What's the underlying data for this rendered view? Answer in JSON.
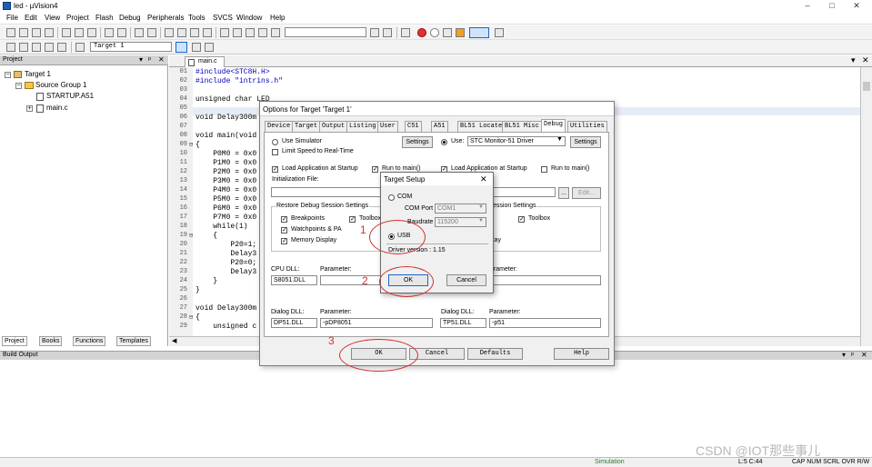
{
  "window": {
    "title": "led - µVision4",
    "minimize": "–",
    "maximize": "□",
    "close": "✕"
  },
  "menu": [
    "File",
    "Edit",
    "View",
    "Project",
    "Flash",
    "Debug",
    "Peripherals",
    "Tools",
    "SVCS",
    "Window",
    "Help"
  ],
  "toolbar": {
    "target_select": "Target 1"
  },
  "project_panel": {
    "header": "Project",
    "tree": [
      "Target 1",
      "Source Group 1",
      "STARTUP.A51",
      "main.c"
    ],
    "tabs": [
      "Project",
      "Books",
      "Functions",
      "Templates"
    ]
  },
  "editor": {
    "file_tab": "main.c",
    "lines": [
      {
        "n": "01",
        "t": "#include<STC8H.H>"
      },
      {
        "n": "02",
        "t": "#include \"intrins.h\""
      },
      {
        "n": "03",
        "t": ""
      },
      {
        "n": "04",
        "t": "unsigned char LED"
      },
      {
        "n": "05",
        "t": ""
      },
      {
        "n": "06",
        "t": "void Delay300m"
      },
      {
        "n": "07",
        "t": ""
      },
      {
        "n": "08",
        "t": "void main(void"
      },
      {
        "n": "09",
        "t": "{"
      },
      {
        "n": "10",
        "t": "    P0M0 = 0x0"
      },
      {
        "n": "11",
        "t": "    P1M0 = 0x0"
      },
      {
        "n": "12",
        "t": "    P2M0 = 0x0"
      },
      {
        "n": "13",
        "t": "    P3M0 = 0x0"
      },
      {
        "n": "14",
        "t": "    P4M0 = 0x0"
      },
      {
        "n": "15",
        "t": "    P5M0 = 0x0"
      },
      {
        "n": "16",
        "t": "    P6M0 = 0x0"
      },
      {
        "n": "17",
        "t": "    P7M0 = 0x0"
      },
      {
        "n": "18",
        "t": "    while(1)"
      },
      {
        "n": "19",
        "t": "    {"
      },
      {
        "n": "20",
        "t": "        P20=1;"
      },
      {
        "n": "21",
        "t": "        Delay3"
      },
      {
        "n": "22",
        "t": "        P20=0;"
      },
      {
        "n": "23",
        "t": "        Delay3"
      },
      {
        "n": "24",
        "t": "    }"
      },
      {
        "n": "25",
        "t": "}"
      },
      {
        "n": "26",
        "t": ""
      },
      {
        "n": "27",
        "t": "void Delay300m"
      },
      {
        "n": "28",
        "t": "{"
      },
      {
        "n": "29",
        "t": "    unsigned c"
      }
    ]
  },
  "build_output": {
    "header": "Build Output"
  },
  "statusbar": {
    "mode": "Simulation",
    "position": "L:5 C:44",
    "indicators": "CAP  NUM  SCRL  OVR  R/W"
  },
  "options_dialog": {
    "title": "Options for Target 'Target 1'",
    "tabs": [
      "Device",
      "Target",
      "Output",
      "Listing",
      "User",
      "C51",
      "A51",
      "BL51 Locate",
      "BL51 Misc",
      "Debug",
      "Utilities"
    ],
    "left": {
      "use_simulator": "Use Simulator",
      "settings": "Settings",
      "limit_speed": "Limit Speed to Real-Time",
      "load_app": "Load Application at Startup",
      "run_to_main": "Run to main()",
      "init_file": "Initialization File:",
      "restore_group": "Restore Debug Session Settings",
      "breakpoints": "Breakpoints",
      "toolbox": "Toolbox",
      "watchpoints": "Watchpoints & PA",
      "memory_display": "Memory Display",
      "cpu_dll_label": "CPU DLL:",
      "cpu_param_label": "Parameter:",
      "cpu_dll": "S8051.DLL",
      "cpu_param": "",
      "dialog_dll_label": "Dialog DLL:",
      "dialog_param_label": "Parameter:",
      "dialog_dll": "DP51.DLL",
      "dialog_param": "-pDP8051"
    },
    "right": {
      "use": "Use:",
      "driver": "STC Monitor-51 Driver",
      "settings": "Settings",
      "load_app": "Load Application at Startup",
      "run_to_main": "Run to main()",
      "edit": "Edit...",
      "restore_group": "ession Settings",
      "toolbox": "Toolbox",
      "display_frag": "lay",
      "param_label": "arameter:",
      "dialog_dll_label": "Dialog DLL:",
      "dialog_param_label": "Parameter:",
      "dialog_dll": "TP51.DLL",
      "dialog_param": "-p51"
    },
    "buttons": {
      "ok": "OK",
      "cancel": "Cancel",
      "defaults": "Defaults",
      "help": "Help"
    }
  },
  "target_setup": {
    "title": "Target Setup",
    "close": "✕",
    "com": "COM",
    "com_port_label": "COM Port",
    "com_port": "COM1",
    "baudrate_label": "Baudrate",
    "baudrate": "115200",
    "usb": "USB",
    "driver_version": "Driver version : 1.15",
    "ok": "OK",
    "cancel": "Cancel"
  },
  "annotations": [
    "1",
    "2",
    "3"
  ],
  "annotation_color": "#d32f2f",
  "watermark": "CSDN @IOT那些事儿"
}
